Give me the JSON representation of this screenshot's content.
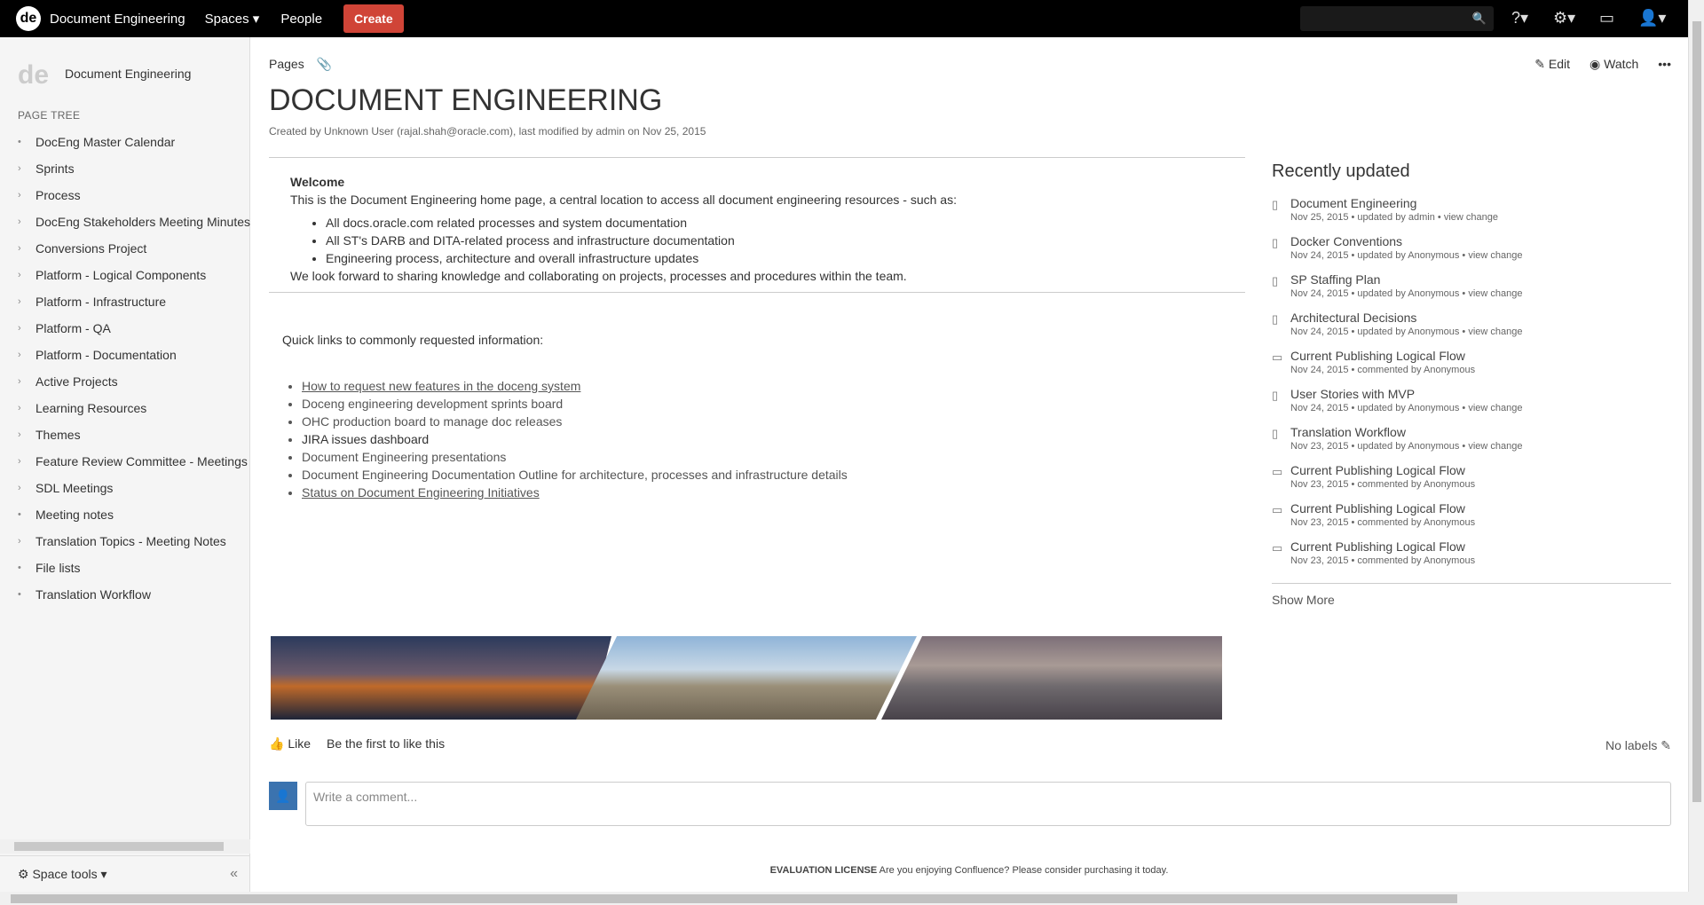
{
  "header": {
    "space_logo": "de",
    "space_name": "Document Engineering",
    "nav_spaces": "Spaces ▾",
    "nav_people": "People",
    "create_label": "Create"
  },
  "sidebar": {
    "logo": "de",
    "space_name": "Document Engineering",
    "tree_title": "PAGE TREE",
    "items": [
      {
        "label": "DocEng Master Calendar",
        "bullet": "•"
      },
      {
        "label": "Sprints",
        "bullet": "›"
      },
      {
        "label": "Process",
        "bullet": "›"
      },
      {
        "label": "DocEng Stakeholders Meeting Minutes",
        "bullet": "›"
      },
      {
        "label": "Conversions Project",
        "bullet": "›"
      },
      {
        "label": "Platform - Logical Components",
        "bullet": "›"
      },
      {
        "label": "Platform - Infrastructure",
        "bullet": "›"
      },
      {
        "label": "Platform - QA",
        "bullet": "›"
      },
      {
        "label": "Platform - Documentation",
        "bullet": "›"
      },
      {
        "label": "Active Projects",
        "bullet": "›"
      },
      {
        "label": "Learning Resources",
        "bullet": "›"
      },
      {
        "label": "Themes",
        "bullet": "›"
      },
      {
        "label": "Feature Review Committee - Meetings",
        "bullet": "›"
      },
      {
        "label": "SDL Meetings",
        "bullet": "›"
      },
      {
        "label": "Meeting notes",
        "bullet": "•"
      },
      {
        "label": "Translation Topics - Meeting Notes",
        "bullet": "›"
      },
      {
        "label": "File lists",
        "bullet": "•"
      },
      {
        "label": "Translation Workflow",
        "bullet": "•"
      }
    ],
    "space_tools": "Space tools ▾",
    "collapse": "«"
  },
  "page": {
    "breadcrumb": "Pages",
    "edit": "Edit",
    "watch": "Watch",
    "more": "•••",
    "title": "DOCUMENT ENGINEERING",
    "meta": "Created by Unknown User (rajal.shah@oracle.com), last modified by admin on Nov 25, 2015",
    "welcome_heading": "Welcome",
    "welcome_intro": "This is the Document Engineering home page, a central location to access all document engineering resources - such as:",
    "welcome_items": [
      "All docs.oracle.com related processes and system documentation",
      "All ST's DARB and DITA-related process and infrastructure documentation",
      "Engineering process, architecture and overall infrastructure updates"
    ],
    "welcome_outro": "We look forward to sharing knowledge and collaborating on projects, processes and procedures within the team.",
    "quick_intro": "Quick links to commonly requested information:",
    "quick_links": [
      "How to request new features in the doceng system",
      "Doceng engineering development sprints board",
      "OHC production board to manage doc releases",
      "JIRA issues dashboard",
      "Document Engineering presentations",
      "Document Engineering Documentation Outline for architecture, processes and infrastructure details",
      "Status on Document Engineering Initiatives"
    ],
    "like": "Like",
    "like_text": "Be the first to like this",
    "no_labels": "No labels",
    "comment_placeholder": "Write a comment..."
  },
  "recent": {
    "title": "Recently updated",
    "items": [
      {
        "title": "Document Engineering",
        "sub": "Nov 25, 2015 • updated by admin • view change",
        "icon": "page"
      },
      {
        "title": "Docker Conventions",
        "sub": "Nov 24, 2015 • updated by Anonymous • view change",
        "icon": "page"
      },
      {
        "title": "SP Staffing Plan",
        "sub": "Nov 24, 2015 • updated by Anonymous • view change",
        "icon": "page"
      },
      {
        "title": "Architectural Decisions",
        "sub": "Nov 24, 2015 • updated by Anonymous • view change",
        "icon": "page"
      },
      {
        "title": "Current Publishing Logical Flow",
        "sub": "Nov 24, 2015 • commented by Anonymous",
        "icon": "comment"
      },
      {
        "title": "User Stories with MVP",
        "sub": "Nov 24, 2015 • updated by Anonymous • view change",
        "icon": "page"
      },
      {
        "title": "Translation Workflow",
        "sub": "Nov 23, 2015 • updated by Anonymous • view change",
        "icon": "page"
      },
      {
        "title": "Current Publishing Logical Flow",
        "sub": "Nov 23, 2015 • commented by Anonymous",
        "icon": "comment"
      },
      {
        "title": "Current Publishing Logical Flow",
        "sub": "Nov 23, 2015 • commented by Anonymous",
        "icon": "comment"
      },
      {
        "title": "Current Publishing Logical Flow",
        "sub": "Nov 23, 2015 • commented by Anonymous",
        "icon": "comment"
      }
    ],
    "show_more": "Show More"
  },
  "license": {
    "label": "EVALUATION LICENSE",
    "text": "Are you enjoying Confluence? Please consider purchasing it today."
  }
}
